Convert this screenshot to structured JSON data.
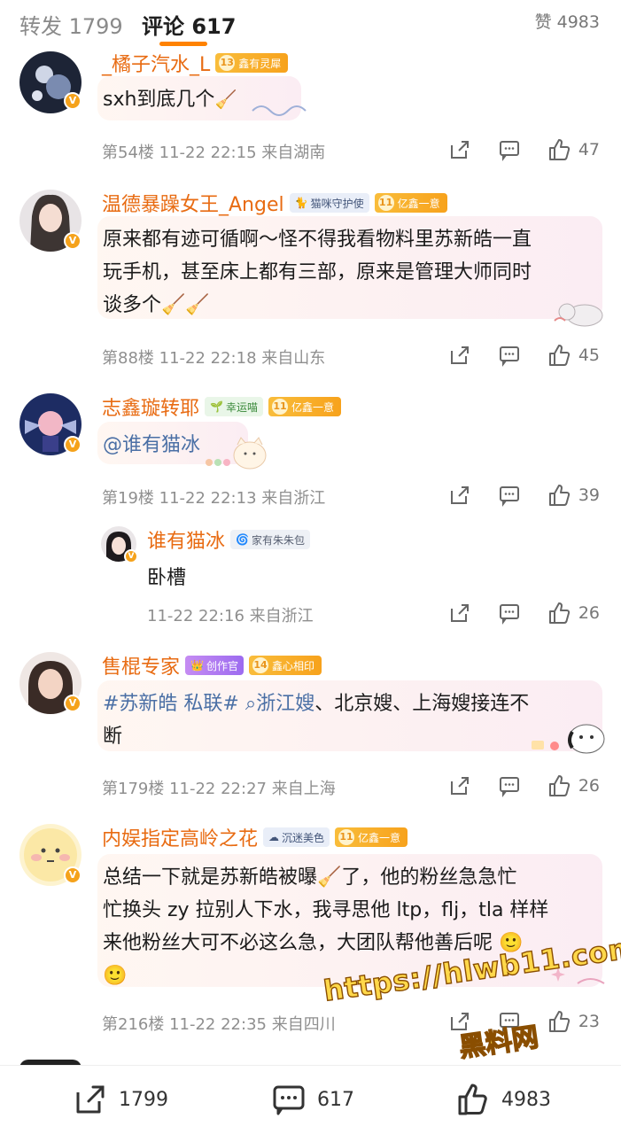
{
  "tabs": {
    "repost": "转发 1799",
    "comments": "评论 617",
    "likes": "赞 4983"
  },
  "comments": [
    {
      "username": "_橘子汽水_L",
      "badges": [
        {
          "level": "13",
          "text": "鑫有灵犀"
        }
      ],
      "text": "sxh到底几个",
      "floor_time": "第54楼 11-22 22:15",
      "location": "来自湖南",
      "likes": "47"
    },
    {
      "username": "温德暴躁女王_Angel",
      "badges": [
        {
          "text": "猫咪守护使"
        },
        {
          "level": "11",
          "text": "亿鑫一意"
        }
      ],
      "text_lines": [
        "原来都有迹可循啊～怪不得我看物料里苏新皓一直",
        "玩手机，甚至床上都有三部，原来是管理大师同时",
        "谈多个"
      ],
      "floor_time": "第88楼 11-22 22:18",
      "location": "来自山东",
      "likes": "45"
    },
    {
      "username": "志鑫璇转耶",
      "badges": [
        {
          "text": "幸运喵"
        },
        {
          "level": "11",
          "text": "亿鑫一意"
        }
      ],
      "text": "@谁有猫冰",
      "floor_time": "第19楼 11-22 22:13",
      "location": "来自浙江",
      "likes": "39",
      "reply": {
        "username": "谁有猫冰",
        "badge": "家有朱朱包",
        "text": "卧槽",
        "time": "11-22 22:16",
        "location": "来自浙江",
        "likes": "26"
      }
    },
    {
      "username": "售棍专家",
      "badges": [
        {
          "text": "创作官"
        },
        {
          "level": "14",
          "text": "鑫心相印"
        }
      ],
      "text_line1_hashtag": "#苏新皓 私联#",
      "text_line1_search": "浙江嫂",
      "text_line1_rest": "、北京嫂、上海嫂接连不",
      "text_line2": "断",
      "floor_time": "第179楼 11-22 22:27",
      "location": "来自上海",
      "likes": "26"
    },
    {
      "username": "内娱指定高岭之花",
      "badges": [
        {
          "text": "沉迷美色"
        },
        {
          "level": "11",
          "text": "亿鑫一意"
        }
      ],
      "text_lines": [
        "总结一下就是苏新皓被曝",
        "了，他的粉丝急急忙",
        "忙换头 zy 拉别人下水，我寻思他 ltp，flj，tla 样样",
        "来他粉丝大可不必这么急，大团队帮他善后呢"
      ],
      "floor_time": "第216楼 11-22 22:35",
      "location": "来自四川",
      "likes": "23"
    }
  ],
  "watermark": {
    "url": "https://hlwb11.com",
    "site": "黑料网"
  },
  "bottom_bar": {
    "share_count": "1799",
    "comment_count": "617",
    "like_count": "4983"
  },
  "icons": {
    "share": "share-icon",
    "comment": "comment-icon",
    "like": "thumbs-up-icon"
  },
  "colors": {
    "accent": "#ff8200",
    "username": "#e86b12",
    "hashtag": "#4a6fa5"
  }
}
